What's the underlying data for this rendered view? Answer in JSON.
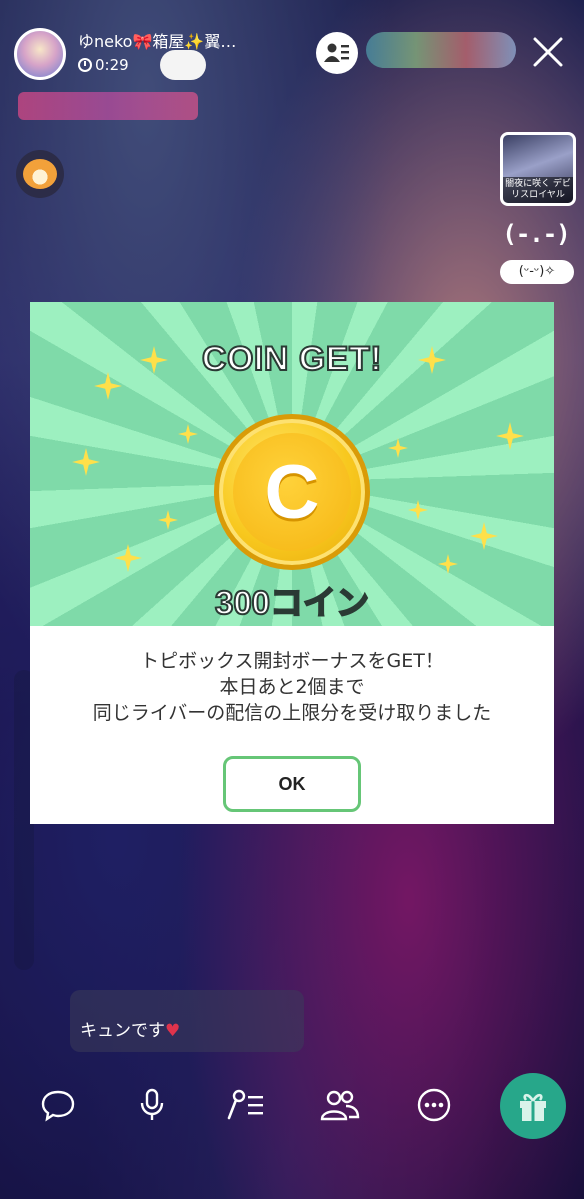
{
  "header": {
    "streamer_name": "ゆneko🎀箱屋✨翼…",
    "elapsed_time": "0:29"
  },
  "side": {
    "event_caption": "闇夜に咲く デビリスロイヤル",
    "kaomoji_large": "(-.-)",
    "kaomoji_pill": "(ᵕ-ᵕ)✧"
  },
  "modal": {
    "title": "COIN GET!",
    "coin_letter": "C",
    "amount": "300コイン",
    "message_lines": [
      "トピボックス開封ボーナスをGET！",
      "本日あと2個まで",
      "同じライバーの配信の上限分を受け取りました"
    ],
    "ok_label": "OK"
  },
  "chat": {
    "last_message": "キュンです",
    "heart": "♥"
  },
  "colors": {
    "modal_green": "#86e0b0",
    "ok_border": "#66c677",
    "coin_gold": "#f8c81e",
    "gift_teal": "#27a78a"
  },
  "icons": [
    "clock-icon",
    "viewer-list-icon",
    "close-icon",
    "comment-icon",
    "microphone-icon",
    "singing-icon",
    "collab-icon",
    "more-icon",
    "gift-icon"
  ]
}
